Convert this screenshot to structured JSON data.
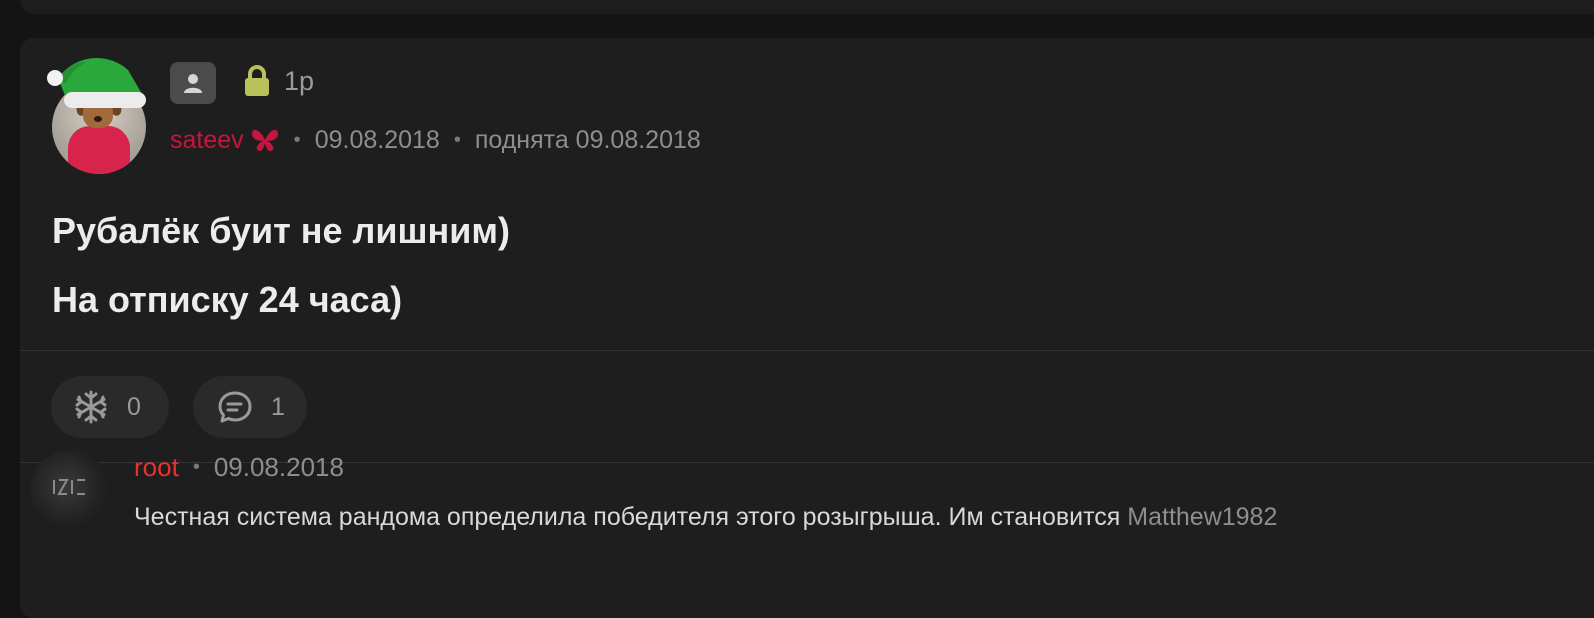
{
  "post": {
    "reputation": "1р",
    "author": "sateev",
    "date": "09.08.2018",
    "bumped": "поднята 09.08.2018",
    "lines": [
      "Рубалёк буит не лишним)",
      "На отписку 24 часа)"
    ],
    "icons": [
      "santa-hat-icon",
      "user-icon",
      "lock-icon",
      "butterfly-icon"
    ],
    "colors": {
      "author": "#c5163f",
      "lock": "#b9c25a",
      "background": "#1e1e1e"
    }
  },
  "actions": {
    "likes_count": "0",
    "comments_count": "1",
    "icons": [
      "snowflake-icon",
      "comment-icon"
    ]
  },
  "comment": {
    "author": "root",
    "date": "09.08.2018",
    "text": "Честная система рандома определила победителя этого розыгрыша. Им становится ",
    "winner": "Matthew1982",
    "colors": {
      "author": "#e8322e"
    }
  }
}
